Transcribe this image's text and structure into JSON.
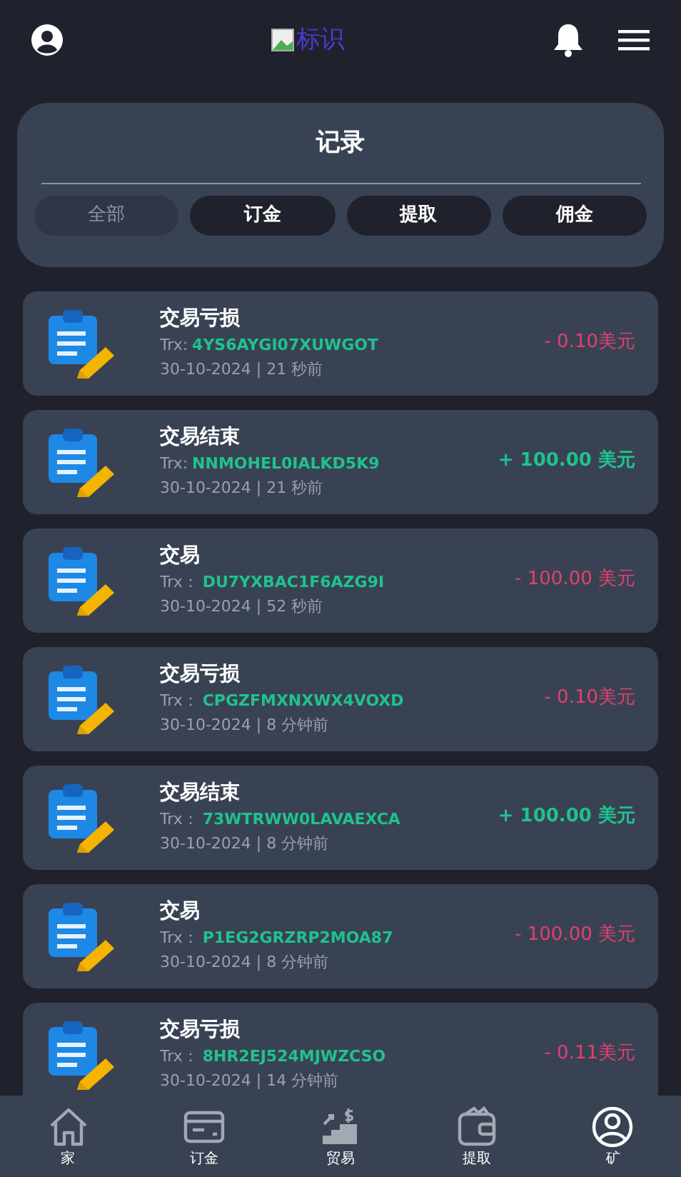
{
  "header": {
    "logo_alt": "标识"
  },
  "panel": {
    "title": "记录",
    "tabs": [
      {
        "label": "全部",
        "selected": true
      },
      {
        "label": "订金",
        "selected": false
      },
      {
        "label": "提取",
        "selected": false
      },
      {
        "label": "佣金",
        "selected": false
      }
    ]
  },
  "records": [
    {
      "title": "交易亏损",
      "trx_label": "Trx:",
      "trx": "4YS6AYGI07XUWGOT",
      "time": "30-10-2024 | 21 秒前",
      "amount": "- 0.10美元",
      "kind": "debit"
    },
    {
      "title": "交易结束",
      "trx_label": "Trx:",
      "trx": "NNMOHEL0IALKD5K9",
      "time": "30-10-2024 | 21 秒前",
      "amount": "+ 100.00 美元",
      "kind": "credit"
    },
    {
      "title": "交易",
      "trx_label": "Trx：",
      "trx": "DU7YXBAC1F6AZG9I",
      "time": "30-10-2024 | 52 秒前",
      "amount": "- 100.00 美元",
      "kind": "debit"
    },
    {
      "title": "交易亏损",
      "trx_label": "Trx：",
      "trx": "CPGZFMXNXWX4VOXD",
      "time": "30-10-2024 | 8 分钟前",
      "amount": "- 0.10美元",
      "kind": "debit"
    },
    {
      "title": "交易结束",
      "trx_label": "Trx：",
      "trx": "73WTRWW0LAVAEXCA",
      "time": "30-10-2024 | 8 分钟前",
      "amount": "+ 100.00 美元",
      "kind": "credit"
    },
    {
      "title": "交易",
      "trx_label": "Trx：",
      "trx": "P1EG2GRZRP2MOA87",
      "time": "30-10-2024 | 8 分钟前",
      "amount": "- 100.00 美元",
      "kind": "debit"
    },
    {
      "title": "交易亏损",
      "trx_label": "Trx：",
      "trx": "8HR2EJ524MJWZCSO",
      "time": "30-10-2024 | 14 分钟前",
      "amount": "- 0.11美元",
      "kind": "debit"
    }
  ],
  "bottom_nav": [
    {
      "label": "家",
      "kind": "home",
      "selected": false
    },
    {
      "label": "订金",
      "kind": "card",
      "selected": false
    },
    {
      "label": "贸易",
      "kind": "trade",
      "selected": false
    },
    {
      "label": "提取",
      "kind": "wallet",
      "selected": false
    },
    {
      "label": "矿",
      "kind": "user",
      "selected": true
    }
  ]
}
